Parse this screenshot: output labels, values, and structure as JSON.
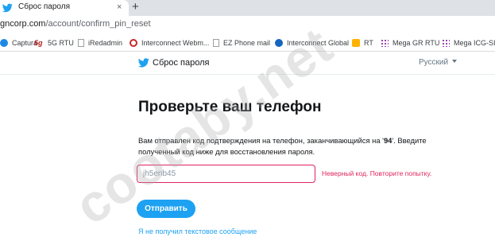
{
  "browser": {
    "tab": {
      "title": "Сброс пароля",
      "close": "×"
    },
    "new_tab": "+",
    "url_host": "gncorp.com",
    "url_path": "/account/confirm_pin_reset",
    "bookmarks": [
      {
        "label": "Captura",
        "icon": "captura-icon",
        "color": "#1e88e5"
      },
      {
        "label": "5G RTU",
        "icon": "5g-logo-icon",
        "color": "#b71c1c"
      },
      {
        "label": "iRedadmin",
        "icon": "page-icon",
        "color": "#9e9e9e"
      },
      {
        "label": "Interconnect Webm...",
        "icon": "interconnect-icon",
        "color": "#c62828"
      },
      {
        "label": "EZ Phone mail",
        "icon": "page-icon",
        "color": "#9e9e9e"
      },
      {
        "label": "Interconnect Global",
        "icon": "globe-icon",
        "color": "#1565c0"
      },
      {
        "label": "RT",
        "icon": "rt-icon",
        "color": "#ffb300"
      },
      {
        "label": "Mega GR RTU",
        "icon": "mega-icon",
        "color": "#8e24aa"
      },
      {
        "label": "Mega ICG-SIP",
        "icon": "mega-icon",
        "color": "#8e24aa"
      }
    ]
  },
  "header": {
    "title": "Сброс пароля",
    "language": "Русский"
  },
  "main": {
    "title": "Проверьте ваш телефон",
    "description_before": "Вам отправлен код подтверждения на телефон, заканчивающийся на '",
    "description_digits": "94",
    "description_after": "'. Введите полученный код ниже для восстановления пароля.",
    "pin_value": "jh5enb45",
    "error": "Неверный код. Повторите попытку.",
    "submit_label": "Отправить",
    "no_sms_link": "Я не получил текстовое сообщение"
  },
  "watermark": "cootaby.net",
  "colors": {
    "brand_blue": "#1da1f2",
    "error_red": "#e0245e",
    "text_dark": "#14171a"
  }
}
